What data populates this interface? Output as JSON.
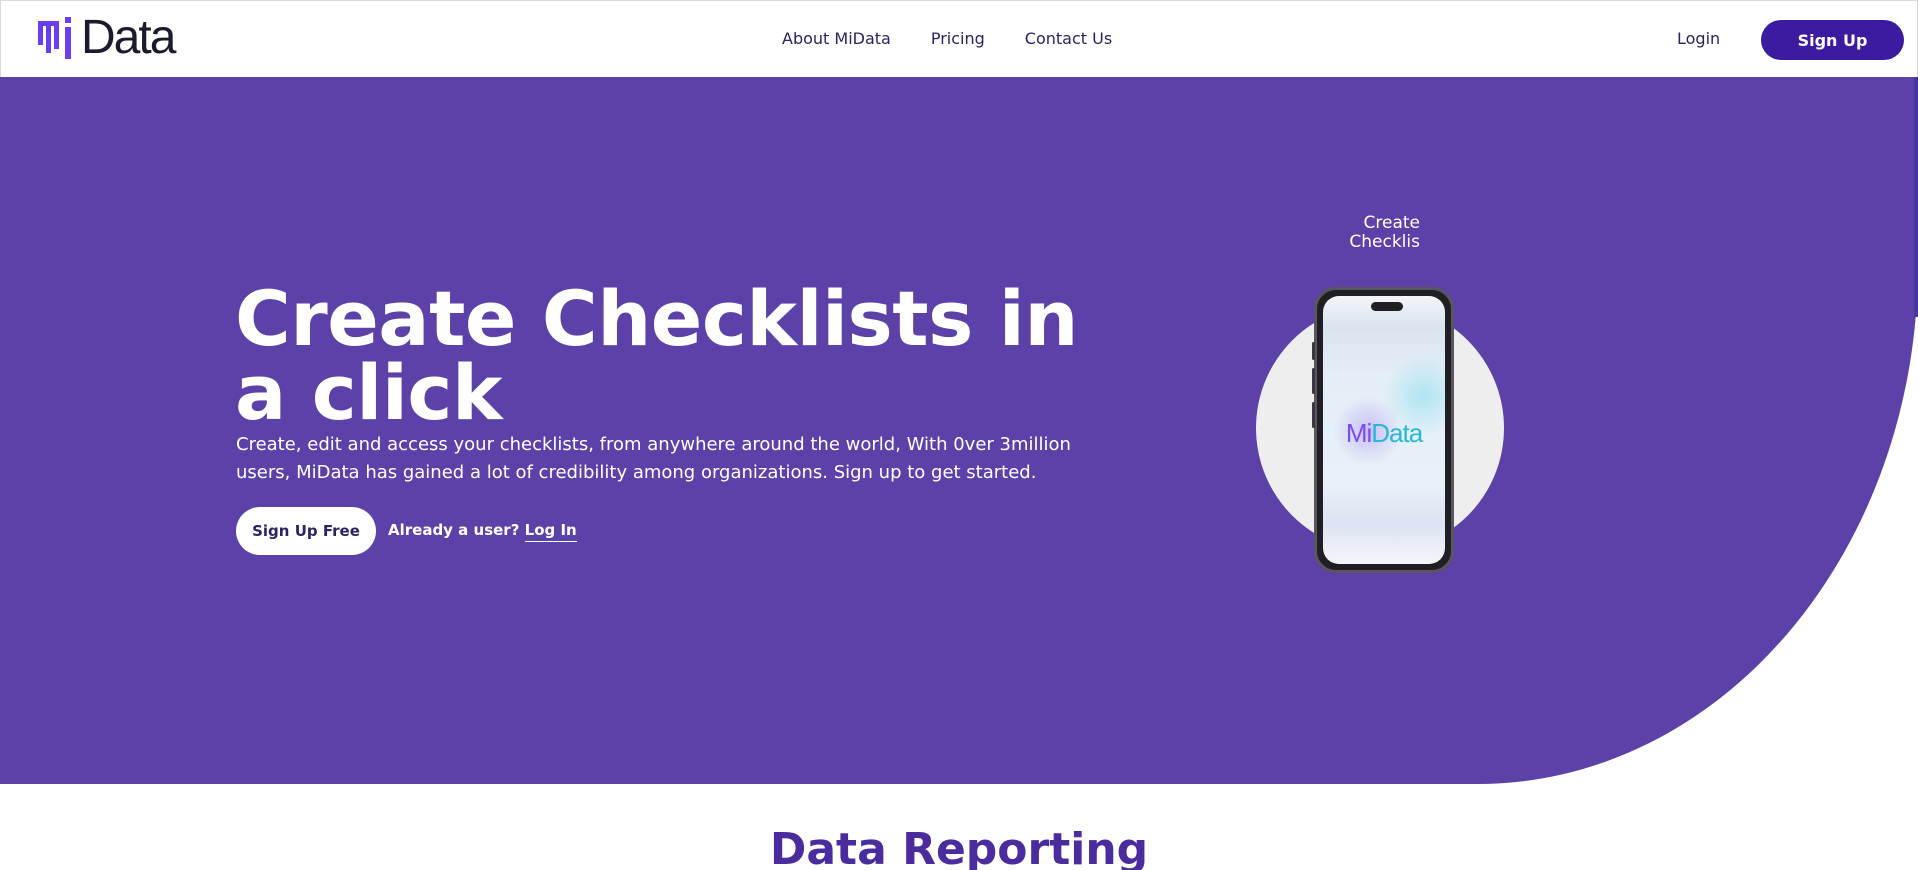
{
  "brand": {
    "logo_mi": "Mi",
    "logo_data": "Data",
    "accent": "#5c42a8",
    "dark_accent": "#3b1ba0"
  },
  "nav": {
    "items": [
      "About MiData",
      "Pricing",
      "Contact Us"
    ],
    "login": "Login",
    "signup": "Sign Up"
  },
  "hero": {
    "title": "Create Checklists in a click",
    "subtitle": "Create, edit and access your checklists, from anywhere around the world, With 0ver 3million users, MiData has gained a lot of credibility among organizations. Sign up to get started.",
    "cta": "Sign Up Free",
    "already_text": "Already a user?",
    "login_link": "Log In",
    "phone_caption_line1": "Create",
    "phone_caption_line2": "Checklis",
    "phone_logo_mi": "Mi",
    "phone_logo_data": "Data"
  },
  "section": {
    "title": "Data Reporting"
  }
}
